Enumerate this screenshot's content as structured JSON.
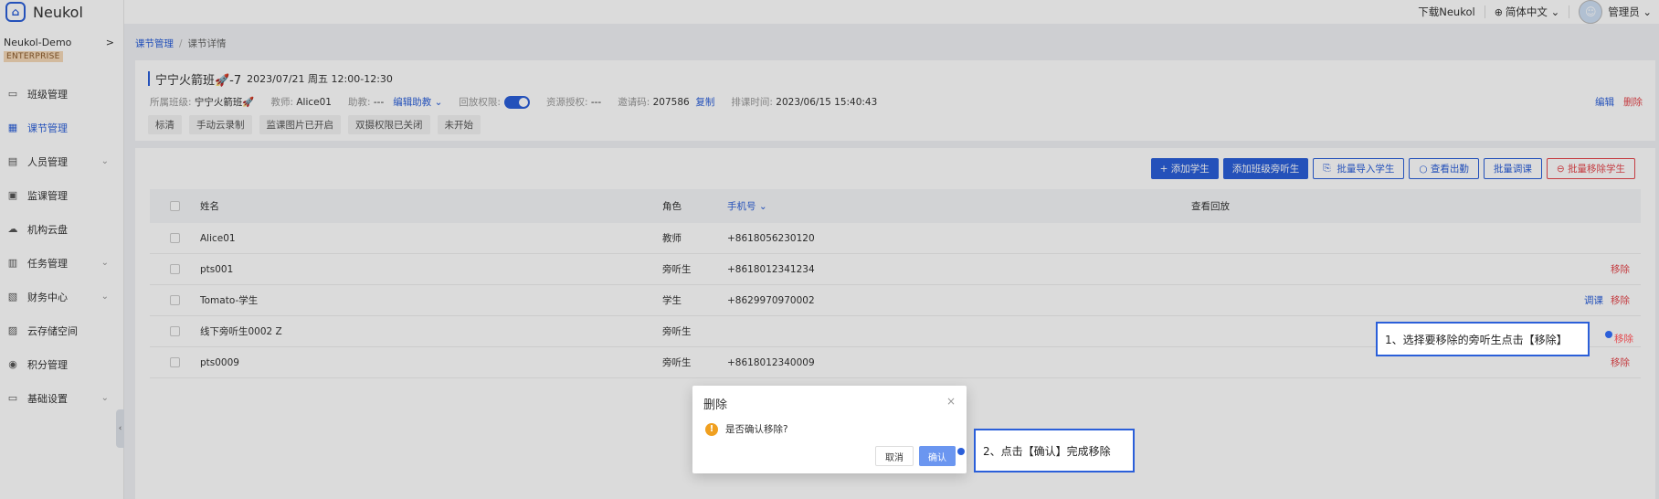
{
  "app": {
    "name": "Neukol",
    "logo_glyph": "⌂"
  },
  "org": {
    "name": "Neukol-Demo",
    "badge": "ENTERPRISE",
    "arrow": ">"
  },
  "sidebar": {
    "items": [
      {
        "label": "班级管理",
        "icon": "▭",
        "active": false,
        "arrow": ""
      },
      {
        "label": "课节管理",
        "icon": "▦",
        "active": true,
        "arrow": ""
      },
      {
        "label": "人员管理",
        "icon": "▤",
        "active": false,
        "arrow": "⌄"
      },
      {
        "label": "监课管理",
        "icon": "▣",
        "active": false,
        "arrow": ""
      },
      {
        "label": "机构云盘",
        "icon": "☁",
        "active": false,
        "arrow": ""
      },
      {
        "label": "任务管理",
        "icon": "▥",
        "active": false,
        "arrow": "⌄"
      },
      {
        "label": "财务中心",
        "icon": "▧",
        "active": false,
        "arrow": "⌄"
      },
      {
        "label": "云存储空间",
        "icon": "▨",
        "active": false,
        "arrow": ""
      },
      {
        "label": "积分管理",
        "icon": "◉",
        "active": false,
        "arrow": ""
      },
      {
        "label": "基础设置",
        "icon": "▭",
        "active": false,
        "arrow": "⌄"
      }
    ],
    "collapse_glyph": "‹"
  },
  "header": {
    "download": "下载Neukol",
    "language": "简体中文",
    "language_arrow": "⌄",
    "globe": "⊕",
    "user": "管理员",
    "user_arrow": "⌄"
  },
  "breadcrumb": {
    "parent": "课节管理",
    "sep": "/",
    "current": "课节详情"
  },
  "lesson": {
    "title": "宁宁火箭班🚀-7",
    "time": "2023/07/21 周五 12:00-12:30",
    "class_label": "所属班级:",
    "class_value": "宁宁火箭班🚀",
    "teacher_label": "教师:",
    "teacher_value": "Alice01",
    "assistant_label": "助教:",
    "assistant_value": "---",
    "edit_assistant": "编辑助教 ⌄",
    "playback_label": "回放权限:",
    "playback_on": true,
    "resource_label": "资源授权:",
    "resource_value": "---",
    "invite_label": "邀请码:",
    "invite_value": "207586",
    "copy": "复制",
    "schedule_label": "排课时间:",
    "schedule_value": "2023/06/15 15:40:43",
    "edit": "编辑",
    "delete": "删除",
    "tags": [
      "标清",
      "手动云录制",
      "监课图片已开启",
      "双摄权限已关闭",
      "未开始"
    ]
  },
  "toolbar": {
    "add_student": "+ 添加学生",
    "add_class_auditor": "添加班级旁听生",
    "batch_import": "批量导入学生",
    "view_attendance": "○ 查看出勤",
    "batch_transfer": "批量调课",
    "batch_remove": "批量移除学生",
    "import_icon": "⎘",
    "remove_icon": "⊖"
  },
  "table": {
    "headers": {
      "name": "姓名",
      "role": "角色",
      "phone": "手机号 ⌄",
      "playback": "查看回放"
    },
    "rows": [
      {
        "name": "Alice01",
        "role": "教师",
        "phone": "+8618056230120",
        "transfer": "",
        "remove": ""
      },
      {
        "name": "pts001",
        "role": "旁听生",
        "phone": "+8618012341234",
        "transfer": "",
        "remove": "移除"
      },
      {
        "name": "Tomato-学生",
        "role": "学生",
        "phone": "+8629970970002",
        "transfer": "调课",
        "remove": "移除"
      },
      {
        "name": "线下旁听生0002 Z",
        "role": "旁听生",
        "phone": "",
        "transfer": "",
        "remove": ""
      },
      {
        "name": "pts0009",
        "role": "旁听生",
        "phone": "+8618012340009",
        "transfer": "",
        "remove": "移除"
      }
    ]
  },
  "dialog": {
    "title": "删除",
    "close": "×",
    "warn_glyph": "!",
    "message": "是否确认移除?",
    "cancel": "取消",
    "confirm": "确认"
  },
  "callouts": {
    "step1": "1、选择要移除的旁听生点击【移除】",
    "step1_target": "移除",
    "step2": "2、点击【确认】完成移除"
  },
  "colors": {
    "primary": "#2b5fd9",
    "danger": "#e5484d",
    "warning": "#f0a020",
    "badge_bg": "#f5d9b8"
  }
}
